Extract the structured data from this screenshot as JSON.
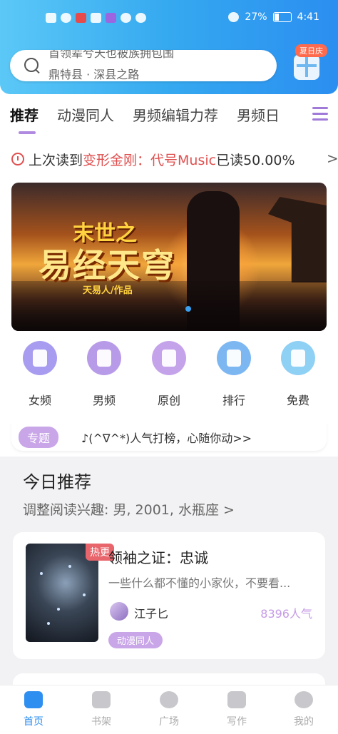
{
  "status_bar": {
    "battery": "27%",
    "time": "4:41"
  },
  "search": {
    "rolling_text_1": "首领辈兮天也被族拥包围",
    "rolling_text_2": "鼎特县 · 深县之路"
  },
  "gift_badge": "夏日庆",
  "tabs": [
    {
      "label": "推荐",
      "active": true
    },
    {
      "label": "动漫同人",
      "active": false
    },
    {
      "label": "男频编辑力荐",
      "active": false
    },
    {
      "label": "男频日",
      "active": false
    }
  ],
  "last_read": {
    "prefix": "上次读到",
    "book": "变形金刚：代号Music",
    "suffix": "已读50.00%",
    "arrow": ">"
  },
  "banner": {
    "title_small": "末世之",
    "title_big": "易经天穹",
    "author_line": "天易人/作品"
  },
  "categories": [
    {
      "label": "女频",
      "icon": "dress-icon",
      "color": "#a79cf0"
    },
    {
      "label": "男频",
      "icon": "shirt-icon",
      "color": "#b89be8"
    },
    {
      "label": "原创",
      "icon": "book-icon",
      "color": "#c5a3ea"
    },
    {
      "label": "排行",
      "icon": "trophy-icon",
      "color": "#7db7f2"
    },
    {
      "label": "免费",
      "icon": "yuan-coin-icon",
      "color": "#8fd0f5"
    }
  ],
  "topic": {
    "badge": "专题",
    "text": "♪(^∇^*)人气打榜，心随你动>>"
  },
  "recommend": {
    "title": "今日推荐",
    "subtitle": "调整阅读兴趣: 男, 2001, 水瓶座 >"
  },
  "book": {
    "badge": "热更",
    "title": "领袖之证：忠诚",
    "description": "一些什么都不懂的小家伙，不要看...",
    "author": "江子匕",
    "popularity": "8396人气",
    "tag": "动漫同人"
  },
  "bottom_nav": [
    {
      "label": "首页",
      "icon": "home-icon",
      "active": true
    },
    {
      "label": "书架",
      "icon": "bookshelf-icon",
      "active": false
    },
    {
      "label": "广场",
      "icon": "planet-icon",
      "active": false
    },
    {
      "label": "写作",
      "icon": "pen-icon",
      "active": false
    },
    {
      "label": "我的",
      "icon": "chat-icon",
      "active": false
    }
  ],
  "colors": {
    "header_gradient_start": "#5bc8f7",
    "header_gradient_end": "#2b8ef0",
    "accent_purple": "#c9a6e8",
    "highlight_red": "#e05050",
    "nav_active_blue": "#2f8ff0"
  }
}
